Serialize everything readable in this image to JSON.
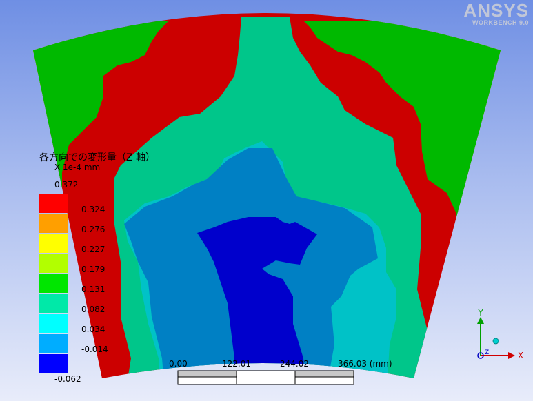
{
  "logo": {
    "brand": "ANSYS",
    "product": "WORKBENCH 9.0"
  },
  "legend": {
    "title": "各方向での変形量（Z 軸）",
    "unit": "X 1e-4 mm",
    "max": "0.372",
    "labels": [
      "0.324",
      "0.276",
      "0.227",
      "0.179",
      "0.131",
      "0.082",
      "0.034",
      "-0.014",
      "-0.062"
    ],
    "colors": [
      "#ff0000",
      "#ff9f00",
      "#ffff00",
      "#b2ff00",
      "#00e600",
      "#00e9a8",
      "#00ffff",
      "#00adff",
      "#0000ff"
    ]
  },
  "contour_colors": [
    "#0000cc",
    "#0080c4",
    "#00c2c7",
    "#00c68a",
    "#00b900",
    "#86c400",
    "#c8c600",
    "#cc8000",
    "#cc0000"
  ],
  "scale_bar": {
    "ticks": [
      "0.00",
      "122.01",
      "244.02",
      "366.03 (mm)"
    ]
  },
  "triad": {
    "x_label": "X",
    "y_label": "Y",
    "z_label": "Z"
  }
}
